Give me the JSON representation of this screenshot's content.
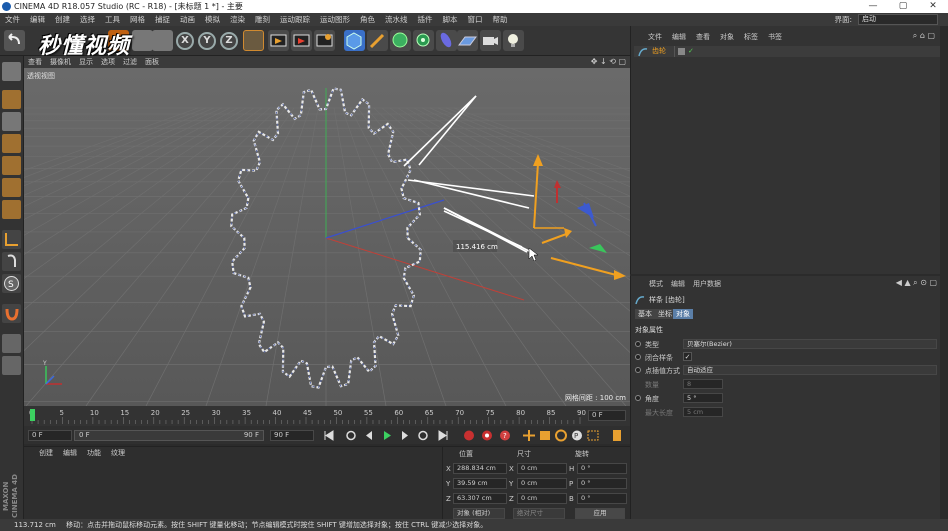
{
  "titlebar": {
    "title": "CINEMA 4D R18.057 Studio (RC - R18) - [未标题 1 *] - 主要",
    "min": "—",
    "max": "▢",
    "close": "✕"
  },
  "menubar": {
    "items": [
      "文件",
      "编辑",
      "创建",
      "选择",
      "工具",
      "网格",
      "捕捉",
      "动画",
      "模拟",
      "渲染",
      "雕刻",
      "运动跟踪",
      "运动图形",
      "角色",
      "流水线",
      "插件",
      "脚本",
      "窗口",
      "帮助"
    ],
    "interface_label": "界面:",
    "interface_value": "启动"
  },
  "toolbar": {
    "axis_x": "X",
    "axis_y": "Y",
    "axis_z": "Z"
  },
  "watermark": "秒懂视频",
  "viewport": {
    "menu": [
      "查看",
      "摄像机",
      "显示",
      "选项",
      "过滤",
      "面板"
    ],
    "label": "透视视图",
    "grid_spacing": "网格间距 : 100 cm",
    "measure": "115.416 cm"
  },
  "timeline": {
    "ticks": [
      "0",
      "5",
      "10",
      "15",
      "20",
      "25",
      "30",
      "35",
      "40",
      "45",
      "50",
      "55",
      "60",
      "65",
      "70",
      "75",
      "80",
      "85",
      "90"
    ],
    "end_field": "0 F"
  },
  "transport": {
    "start": "0 F",
    "current": "0 F",
    "end_range": "90 F",
    "max": "90 F"
  },
  "material": {
    "menu": [
      "创建",
      "编辑",
      "功能",
      "纹理"
    ]
  },
  "coords": {
    "headers": [
      "位置",
      "尺寸",
      "旋转"
    ],
    "rows": [
      {
        "axis": "X",
        "pos": "288.834 cm",
        "saxis": "X",
        "size": "0 cm",
        "raxis": "H",
        "rot": "0 °"
      },
      {
        "axis": "Y",
        "pos": "39.59 cm",
        "saxis": "Y",
        "size": "0 cm",
        "raxis": "P",
        "rot": "0 °"
      },
      {
        "axis": "Z",
        "pos": "63.307 cm",
        "saxis": "Z",
        "size": "0 cm",
        "raxis": "B",
        "rot": "0 °"
      }
    ],
    "mode1": "对象 (相对)",
    "mode2": "绝对尺寸",
    "apply": "应用"
  },
  "object_manager": {
    "menu": [
      "文件",
      "编辑",
      "查看",
      "对象",
      "标签",
      "书签"
    ],
    "object_name": "齿轮"
  },
  "attributes": {
    "menu": [
      "模式",
      "编辑",
      "用户数据"
    ],
    "title": "样条 [齿轮]",
    "tabs": [
      "基本",
      "坐标",
      "对象"
    ],
    "section": "对象属性",
    "rows": [
      {
        "label": "类型",
        "value": "贝塞尔(Bezier)"
      },
      {
        "label": "闭合样条",
        "value": "✓"
      },
      {
        "label": "点插值方式",
        "value": "自动适应"
      },
      {
        "label": "数量",
        "value": "8"
      },
      {
        "label": "角度",
        "value": "5 °"
      },
      {
        "label": "最大长度",
        "value": "5 cm"
      }
    ]
  },
  "statusbar": {
    "coord": "113.712 cm",
    "text": "移动：点击并拖动鼠标移动元素。按住 SHIFT 键量化移动；节点编辑模式时按住 SHIFT 键增加选择对象；按住 CTRL 键减少选择对象。"
  },
  "maxon": "MAXON CINEMA 4D",
  "colors": {
    "bg": "#2b2b2b",
    "viewport": "#5e5e5e",
    "accent_blue": "#5b7fa8",
    "axis_red": "#e03a30",
    "axis_green": "#39c65b",
    "axis_blue": "#3c6ae0",
    "gizmo_orange": "#f0a020"
  }
}
